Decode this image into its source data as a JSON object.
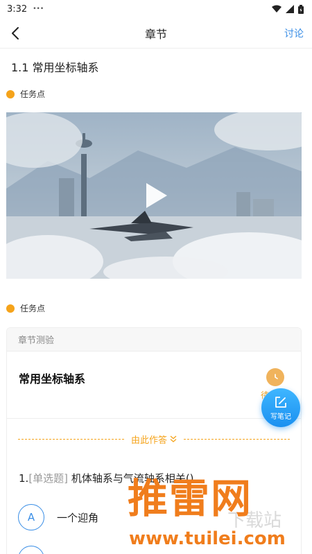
{
  "status_bar": {
    "time": "3:32",
    "dots": "•••",
    "icons": [
      "wifi-icon",
      "signal-icon",
      "battery-icon"
    ]
  },
  "nav": {
    "title": "章节",
    "discuss": "讨论",
    "back_icon": "chevron-left-icon"
  },
  "section": {
    "title": "1.1 常用坐标轴系"
  },
  "task_points": [
    "任务点",
    "任务点"
  ],
  "video": {
    "play_icon": "play-icon"
  },
  "quiz": {
    "header": "章节测验",
    "name": "常用坐标轴系",
    "status": "待",
    "answer_here": "由此作答",
    "question_number": "1.",
    "question_type": "[单选题]",
    "question_text": "机体轴系与气流轴系相关()",
    "options": [
      {
        "letter": "A",
        "text": "一个迎角"
      },
      {
        "letter": "B",
        "text": ""
      }
    ]
  },
  "fab": {
    "label": "写笔记",
    "icon": "edit-note-icon"
  },
  "watermark": {
    "logo": "推雷网",
    "url": "www.tuilei.com",
    "ghost": "下载站"
  },
  "colors": {
    "accent": "#3a8ee6",
    "orange": "#f5a31a",
    "fab": "#1a90f0"
  }
}
